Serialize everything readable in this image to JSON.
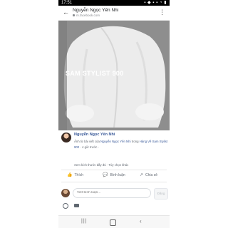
{
  "status_bar": {
    "time": "17:51",
    "icons": "▪ ◆ ▪ ▪  ◔ ▮"
  },
  "header": {
    "title": "Nguyễn Ngọc Yến Nhi",
    "url": "m.facebook.com"
  },
  "photo": {
    "caption": "SAM STYLIST 900"
  },
  "post": {
    "author": "Nguyễn Ngọc Yến Nhi",
    "desc_prefix": "Ảnh từ bài viết của",
    "desc_author": "Nguyễn Ngọc Yến Nhi",
    "desc_mid": "trong",
    "desc_group": "Hàng Về Sam Stylist 900",
    "desc_time": "· 4 giờ trước ·",
    "more_link": "Xem kích thước đầy đủ · Tùy chọn khác"
  },
  "actions": {
    "like": "Thích",
    "comment": "Bình luận",
    "share": "Chia sẻ"
  },
  "comment_box": {
    "placeholder": "Viết bình luận...",
    "send": "Đăng"
  }
}
